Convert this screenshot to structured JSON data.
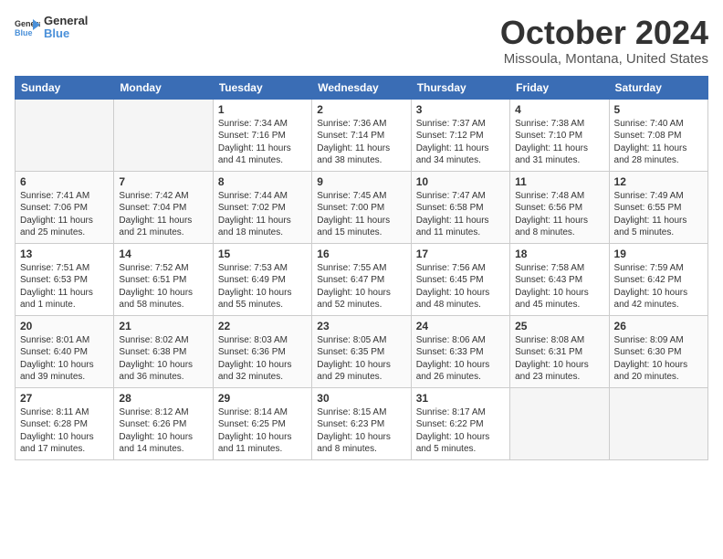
{
  "logo": {
    "text_general": "General",
    "text_blue": "Blue"
  },
  "header": {
    "month": "October 2024",
    "location": "Missoula, Montana, United States"
  },
  "weekdays": [
    "Sunday",
    "Monday",
    "Tuesday",
    "Wednesday",
    "Thursday",
    "Friday",
    "Saturday"
  ],
  "weeks": [
    [
      {
        "day": "",
        "empty": true
      },
      {
        "day": "",
        "empty": true
      },
      {
        "day": "1",
        "sunrise": "Sunrise: 7:34 AM",
        "sunset": "Sunset: 7:16 PM",
        "daylight": "Daylight: 11 hours and 41 minutes."
      },
      {
        "day": "2",
        "sunrise": "Sunrise: 7:36 AM",
        "sunset": "Sunset: 7:14 PM",
        "daylight": "Daylight: 11 hours and 38 minutes."
      },
      {
        "day": "3",
        "sunrise": "Sunrise: 7:37 AM",
        "sunset": "Sunset: 7:12 PM",
        "daylight": "Daylight: 11 hours and 34 minutes."
      },
      {
        "day": "4",
        "sunrise": "Sunrise: 7:38 AM",
        "sunset": "Sunset: 7:10 PM",
        "daylight": "Daylight: 11 hours and 31 minutes."
      },
      {
        "day": "5",
        "sunrise": "Sunrise: 7:40 AM",
        "sunset": "Sunset: 7:08 PM",
        "daylight": "Daylight: 11 hours and 28 minutes."
      }
    ],
    [
      {
        "day": "6",
        "sunrise": "Sunrise: 7:41 AM",
        "sunset": "Sunset: 7:06 PM",
        "daylight": "Daylight: 11 hours and 25 minutes."
      },
      {
        "day": "7",
        "sunrise": "Sunrise: 7:42 AM",
        "sunset": "Sunset: 7:04 PM",
        "daylight": "Daylight: 11 hours and 21 minutes."
      },
      {
        "day": "8",
        "sunrise": "Sunrise: 7:44 AM",
        "sunset": "Sunset: 7:02 PM",
        "daylight": "Daylight: 11 hours and 18 minutes."
      },
      {
        "day": "9",
        "sunrise": "Sunrise: 7:45 AM",
        "sunset": "Sunset: 7:00 PM",
        "daylight": "Daylight: 11 hours and 15 minutes."
      },
      {
        "day": "10",
        "sunrise": "Sunrise: 7:47 AM",
        "sunset": "Sunset: 6:58 PM",
        "daylight": "Daylight: 11 hours and 11 minutes."
      },
      {
        "day": "11",
        "sunrise": "Sunrise: 7:48 AM",
        "sunset": "Sunset: 6:56 PM",
        "daylight": "Daylight: 11 hours and 8 minutes."
      },
      {
        "day": "12",
        "sunrise": "Sunrise: 7:49 AM",
        "sunset": "Sunset: 6:55 PM",
        "daylight": "Daylight: 11 hours and 5 minutes."
      }
    ],
    [
      {
        "day": "13",
        "sunrise": "Sunrise: 7:51 AM",
        "sunset": "Sunset: 6:53 PM",
        "daylight": "Daylight: 11 hours and 1 minute."
      },
      {
        "day": "14",
        "sunrise": "Sunrise: 7:52 AM",
        "sunset": "Sunset: 6:51 PM",
        "daylight": "Daylight: 10 hours and 58 minutes."
      },
      {
        "day": "15",
        "sunrise": "Sunrise: 7:53 AM",
        "sunset": "Sunset: 6:49 PM",
        "daylight": "Daylight: 10 hours and 55 minutes."
      },
      {
        "day": "16",
        "sunrise": "Sunrise: 7:55 AM",
        "sunset": "Sunset: 6:47 PM",
        "daylight": "Daylight: 10 hours and 52 minutes."
      },
      {
        "day": "17",
        "sunrise": "Sunrise: 7:56 AM",
        "sunset": "Sunset: 6:45 PM",
        "daylight": "Daylight: 10 hours and 48 minutes."
      },
      {
        "day": "18",
        "sunrise": "Sunrise: 7:58 AM",
        "sunset": "Sunset: 6:43 PM",
        "daylight": "Daylight: 10 hours and 45 minutes."
      },
      {
        "day": "19",
        "sunrise": "Sunrise: 7:59 AM",
        "sunset": "Sunset: 6:42 PM",
        "daylight": "Daylight: 10 hours and 42 minutes."
      }
    ],
    [
      {
        "day": "20",
        "sunrise": "Sunrise: 8:01 AM",
        "sunset": "Sunset: 6:40 PM",
        "daylight": "Daylight: 10 hours and 39 minutes."
      },
      {
        "day": "21",
        "sunrise": "Sunrise: 8:02 AM",
        "sunset": "Sunset: 6:38 PM",
        "daylight": "Daylight: 10 hours and 36 minutes."
      },
      {
        "day": "22",
        "sunrise": "Sunrise: 8:03 AM",
        "sunset": "Sunset: 6:36 PM",
        "daylight": "Daylight: 10 hours and 32 minutes."
      },
      {
        "day": "23",
        "sunrise": "Sunrise: 8:05 AM",
        "sunset": "Sunset: 6:35 PM",
        "daylight": "Daylight: 10 hours and 29 minutes."
      },
      {
        "day": "24",
        "sunrise": "Sunrise: 8:06 AM",
        "sunset": "Sunset: 6:33 PM",
        "daylight": "Daylight: 10 hours and 26 minutes."
      },
      {
        "day": "25",
        "sunrise": "Sunrise: 8:08 AM",
        "sunset": "Sunset: 6:31 PM",
        "daylight": "Daylight: 10 hours and 23 minutes."
      },
      {
        "day": "26",
        "sunrise": "Sunrise: 8:09 AM",
        "sunset": "Sunset: 6:30 PM",
        "daylight": "Daylight: 10 hours and 20 minutes."
      }
    ],
    [
      {
        "day": "27",
        "sunrise": "Sunrise: 8:11 AM",
        "sunset": "Sunset: 6:28 PM",
        "daylight": "Daylight: 10 hours and 17 minutes."
      },
      {
        "day": "28",
        "sunrise": "Sunrise: 8:12 AM",
        "sunset": "Sunset: 6:26 PM",
        "daylight": "Daylight: 10 hours and 14 minutes."
      },
      {
        "day": "29",
        "sunrise": "Sunrise: 8:14 AM",
        "sunset": "Sunset: 6:25 PM",
        "daylight": "Daylight: 10 hours and 11 minutes."
      },
      {
        "day": "30",
        "sunrise": "Sunrise: 8:15 AM",
        "sunset": "Sunset: 6:23 PM",
        "daylight": "Daylight: 10 hours and 8 minutes."
      },
      {
        "day": "31",
        "sunrise": "Sunrise: 8:17 AM",
        "sunset": "Sunset: 6:22 PM",
        "daylight": "Daylight: 10 hours and 5 minutes."
      },
      {
        "day": "",
        "empty": true
      },
      {
        "day": "",
        "empty": true
      }
    ]
  ]
}
